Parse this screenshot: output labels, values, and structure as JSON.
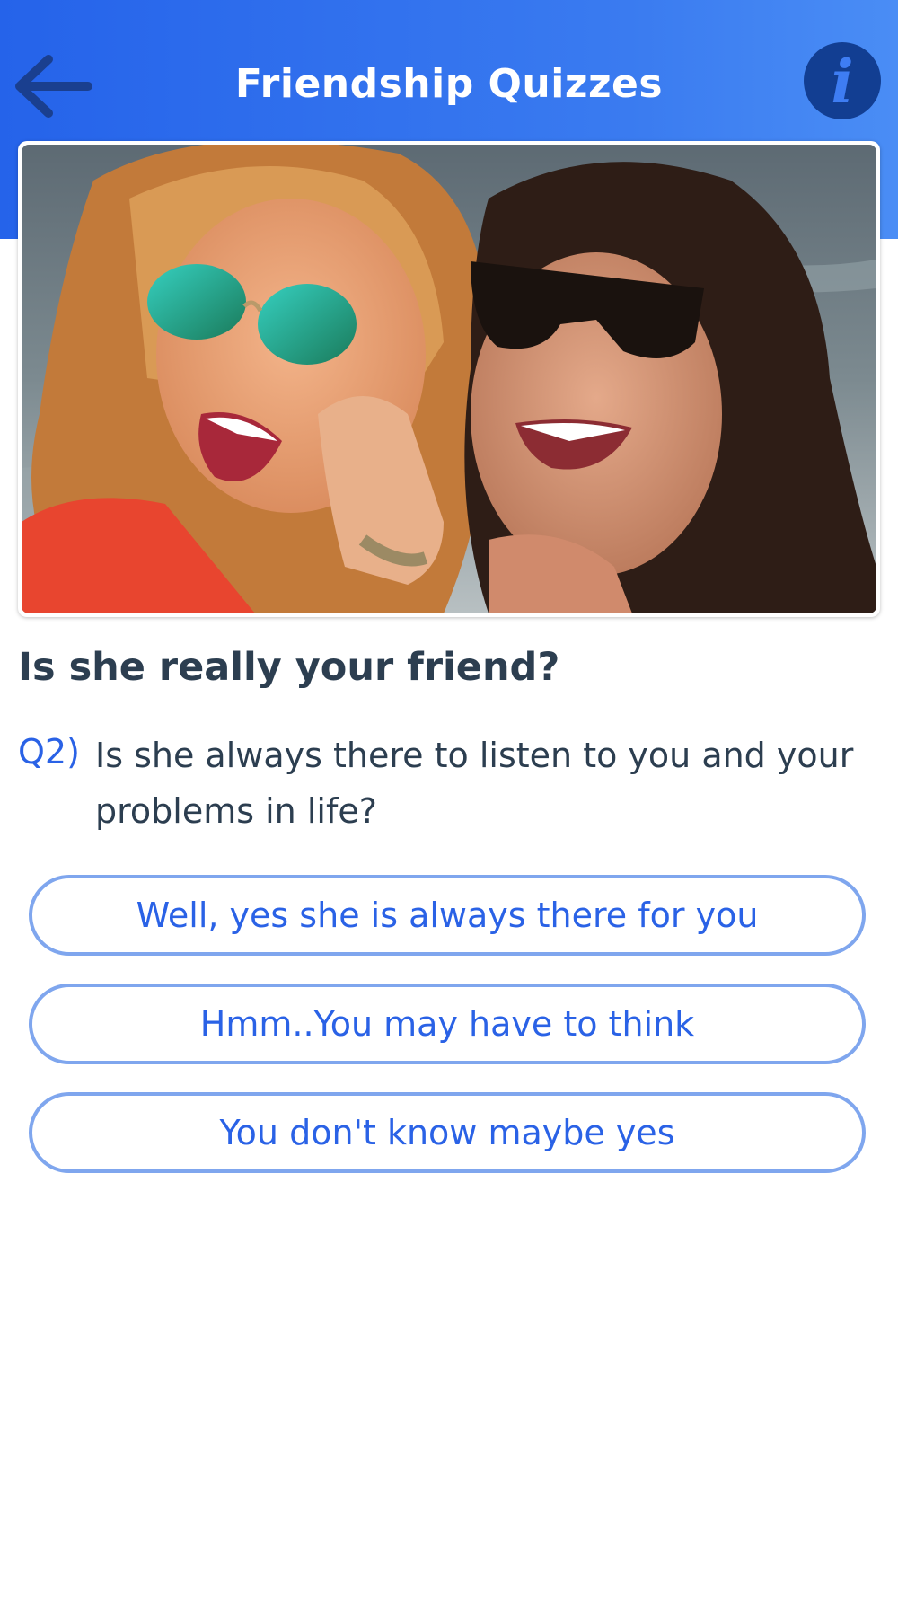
{
  "header": {
    "title": "Friendship Quizzes",
    "back_icon": "arrow-left-icon",
    "info_icon": "info-icon",
    "info_glyph": "i",
    "colors": {
      "bar": "#2563ea",
      "info_circle": "#123e92"
    }
  },
  "quiz": {
    "title": "Is she really your friend?",
    "question_number": "Q2)",
    "question_text": "Is she always there to listen to you and your problems in life?",
    "options": [
      "Well, yes she is always there for you",
      "Hmm..You may have to think",
      "You don't know maybe yes"
    ],
    "accent_color": "#2a62e6"
  }
}
